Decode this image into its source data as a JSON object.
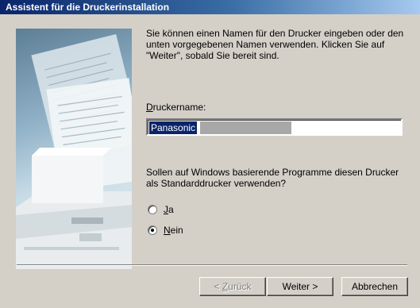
{
  "window": {
    "title": "Assistent für die Druckerinstallation"
  },
  "content": {
    "intro": "Sie können einen Namen für den Drucker eingeben oder den unten vorgegebenen Namen verwenden. Klicken Sie auf \"Weiter\", sobald Sie bereit sind.",
    "printer_name_label_access": "D",
    "printer_name_label_rest": "ruckername:",
    "printer_name_value": "Panasonic",
    "default_question": "Sollen auf Windows basierende Programme diesen Drucker als Standarddrucker verwenden?",
    "options": [
      {
        "access": "J",
        "rest": "a",
        "checked": false
      },
      {
        "access": "N",
        "rest": "ein",
        "checked": true
      }
    ]
  },
  "buttons": {
    "back": {
      "prefix": "< ",
      "access": "Z",
      "rest": "urück",
      "enabled": false
    },
    "next_label": "Weiter >",
    "cancel_label": "Abbrechen"
  },
  "colors": {
    "title_start": "#0a246a",
    "title_end": "#a6caf0",
    "face": "#d4d0c8",
    "selection": "#0a246a"
  },
  "icons": {
    "illustration": "printer-with-documents-image"
  }
}
